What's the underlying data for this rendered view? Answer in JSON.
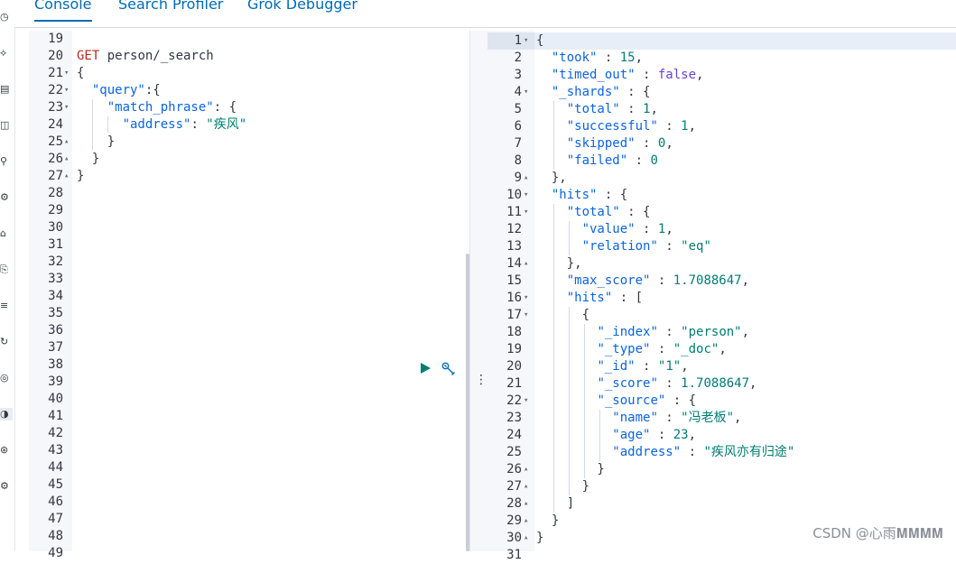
{
  "tabs": [
    {
      "label": "Console",
      "active": true
    },
    {
      "label": "Search Profiler",
      "active": false
    },
    {
      "label": "Grok Debugger",
      "active": false
    }
  ],
  "rail_icons": [
    "clock-icon",
    "discover-icon",
    "dashboard-icon",
    "canvas-icon",
    "maps-icon",
    "ml-icon",
    "stack-icon",
    "graph-icon",
    "logs-icon",
    "apm-icon",
    "uptime-icon",
    "dev-tools-icon",
    "monitoring-icon",
    "management-icon"
  ],
  "request": {
    "lines": [
      {
        "n": "19",
        "fold": "",
        "tokens": []
      },
      {
        "n": "20",
        "fold": "",
        "tokens": [
          {
            "t": "GET",
            "c": "m"
          },
          {
            "t": " person/_search",
            "c": "p"
          }
        ]
      },
      {
        "n": "21",
        "fold": "▾",
        "tokens": [
          {
            "t": "{",
            "c": "p"
          }
        ]
      },
      {
        "n": "22",
        "fold": "▾",
        "tokens": [
          {
            "t": "  ",
            "c": "p"
          },
          {
            "t": "\"query\"",
            "c": "k"
          },
          {
            "t": ":{",
            "c": "p"
          }
        ]
      },
      {
        "n": "23",
        "fold": "▾",
        "tokens": [
          {
            "t": "    ",
            "c": "p"
          },
          {
            "t": "\"match_phrase\"",
            "c": "k"
          },
          {
            "t": ": {",
            "c": "p"
          }
        ]
      },
      {
        "n": "24",
        "fold": "",
        "tokens": [
          {
            "t": "      ",
            "c": "p"
          },
          {
            "t": "\"address\"",
            "c": "k"
          },
          {
            "t": ": ",
            "c": "p"
          },
          {
            "t": "\"疾风\"",
            "c": "s"
          }
        ]
      },
      {
        "n": "25",
        "fold": "▴",
        "tokens": [
          {
            "t": "    }",
            "c": "p"
          }
        ]
      },
      {
        "n": "26",
        "fold": "▴",
        "tokens": [
          {
            "t": "  }",
            "c": "p"
          }
        ]
      },
      {
        "n": "27",
        "fold": "▴",
        "tokens": [
          {
            "t": "}",
            "c": "p"
          }
        ]
      },
      {
        "n": "28",
        "fold": "",
        "tokens": []
      },
      {
        "n": "29",
        "fold": "",
        "tokens": []
      },
      {
        "n": "30",
        "fold": "",
        "tokens": []
      },
      {
        "n": "31",
        "fold": "",
        "tokens": []
      },
      {
        "n": "32",
        "fold": "",
        "tokens": []
      },
      {
        "n": "33",
        "fold": "",
        "tokens": []
      },
      {
        "n": "34",
        "fold": "",
        "tokens": []
      },
      {
        "n": "35",
        "fold": "",
        "tokens": []
      },
      {
        "n": "36",
        "fold": "",
        "tokens": []
      },
      {
        "n": "37",
        "fold": "",
        "tokens": []
      },
      {
        "n": "38",
        "fold": "",
        "tokens": []
      },
      {
        "n": "39",
        "fold": "",
        "tokens": []
      },
      {
        "n": "40",
        "fold": "",
        "tokens": []
      },
      {
        "n": "41",
        "fold": "",
        "tokens": []
      },
      {
        "n": "42",
        "fold": "",
        "tokens": []
      },
      {
        "n": "43",
        "fold": "",
        "tokens": []
      },
      {
        "n": "44",
        "fold": "",
        "tokens": []
      },
      {
        "n": "45",
        "fold": "",
        "tokens": []
      },
      {
        "n": "46",
        "fold": "",
        "tokens": []
      },
      {
        "n": "47",
        "fold": "",
        "tokens": []
      },
      {
        "n": "48",
        "fold": "",
        "tokens": []
      },
      {
        "n": "49",
        "fold": "",
        "tokens": []
      }
    ]
  },
  "response": {
    "lines": [
      {
        "n": "1",
        "fold": "▾",
        "tokens": [
          {
            "t": "{",
            "c": "p"
          }
        ]
      },
      {
        "n": "2",
        "fold": "",
        "tokens": [
          {
            "t": "  ",
            "c": "p"
          },
          {
            "t": "\"took\"",
            "c": "k"
          },
          {
            "t": " : ",
            "c": "p"
          },
          {
            "t": "15",
            "c": "n"
          },
          {
            "t": ",",
            "c": "p"
          }
        ]
      },
      {
        "n": "3",
        "fold": "",
        "tokens": [
          {
            "t": "  ",
            "c": "p"
          },
          {
            "t": "\"timed_out\"",
            "c": "k"
          },
          {
            "t": " : ",
            "c": "p"
          },
          {
            "t": "false",
            "c": "b"
          },
          {
            "t": ",",
            "c": "p"
          }
        ]
      },
      {
        "n": "4",
        "fold": "▾",
        "tokens": [
          {
            "t": "  ",
            "c": "p"
          },
          {
            "t": "\"_shards\"",
            "c": "k"
          },
          {
            "t": " : {",
            "c": "p"
          }
        ]
      },
      {
        "n": "5",
        "fold": "",
        "tokens": [
          {
            "t": "    ",
            "c": "p"
          },
          {
            "t": "\"total\"",
            "c": "k"
          },
          {
            "t": " : ",
            "c": "p"
          },
          {
            "t": "1",
            "c": "n"
          },
          {
            "t": ",",
            "c": "p"
          }
        ]
      },
      {
        "n": "6",
        "fold": "",
        "tokens": [
          {
            "t": "    ",
            "c": "p"
          },
          {
            "t": "\"successful\"",
            "c": "k"
          },
          {
            "t": " : ",
            "c": "p"
          },
          {
            "t": "1",
            "c": "n"
          },
          {
            "t": ",",
            "c": "p"
          }
        ]
      },
      {
        "n": "7",
        "fold": "",
        "tokens": [
          {
            "t": "    ",
            "c": "p"
          },
          {
            "t": "\"skipped\"",
            "c": "k"
          },
          {
            "t": " : ",
            "c": "p"
          },
          {
            "t": "0",
            "c": "n"
          },
          {
            "t": ",",
            "c": "p"
          }
        ]
      },
      {
        "n": "8",
        "fold": "",
        "tokens": [
          {
            "t": "    ",
            "c": "p"
          },
          {
            "t": "\"failed\"",
            "c": "k"
          },
          {
            "t": " : ",
            "c": "p"
          },
          {
            "t": "0",
            "c": "n"
          }
        ]
      },
      {
        "n": "9",
        "fold": "▴",
        "tokens": [
          {
            "t": "  },",
            "c": "p"
          }
        ]
      },
      {
        "n": "10",
        "fold": "▾",
        "tokens": [
          {
            "t": "  ",
            "c": "p"
          },
          {
            "t": "\"hits\"",
            "c": "k"
          },
          {
            "t": " : {",
            "c": "p"
          }
        ]
      },
      {
        "n": "11",
        "fold": "▾",
        "tokens": [
          {
            "t": "    ",
            "c": "p"
          },
          {
            "t": "\"total\"",
            "c": "k"
          },
          {
            "t": " : {",
            "c": "p"
          }
        ]
      },
      {
        "n": "12",
        "fold": "",
        "tokens": [
          {
            "t": "      ",
            "c": "p"
          },
          {
            "t": "\"value\"",
            "c": "k"
          },
          {
            "t": " : ",
            "c": "p"
          },
          {
            "t": "1",
            "c": "n"
          },
          {
            "t": ",",
            "c": "p"
          }
        ]
      },
      {
        "n": "13",
        "fold": "",
        "tokens": [
          {
            "t": "      ",
            "c": "p"
          },
          {
            "t": "\"relation\"",
            "c": "k"
          },
          {
            "t": " : ",
            "c": "p"
          },
          {
            "t": "\"eq\"",
            "c": "s"
          }
        ]
      },
      {
        "n": "14",
        "fold": "▴",
        "tokens": [
          {
            "t": "    },",
            "c": "p"
          }
        ]
      },
      {
        "n": "15",
        "fold": "",
        "tokens": [
          {
            "t": "    ",
            "c": "p"
          },
          {
            "t": "\"max_score\"",
            "c": "k"
          },
          {
            "t": " : ",
            "c": "p"
          },
          {
            "t": "1.7088647",
            "c": "n"
          },
          {
            "t": ",",
            "c": "p"
          }
        ]
      },
      {
        "n": "16",
        "fold": "▾",
        "tokens": [
          {
            "t": "    ",
            "c": "p"
          },
          {
            "t": "\"hits\"",
            "c": "k"
          },
          {
            "t": " : [",
            "c": "p"
          }
        ]
      },
      {
        "n": "17",
        "fold": "▾",
        "tokens": [
          {
            "t": "      {",
            "c": "p"
          }
        ]
      },
      {
        "n": "18",
        "fold": "",
        "tokens": [
          {
            "t": "        ",
            "c": "p"
          },
          {
            "t": "\"_index\"",
            "c": "k"
          },
          {
            "t": " : ",
            "c": "p"
          },
          {
            "t": "\"person\"",
            "c": "s"
          },
          {
            "t": ",",
            "c": "p"
          }
        ]
      },
      {
        "n": "19",
        "fold": "",
        "tokens": [
          {
            "t": "        ",
            "c": "p"
          },
          {
            "t": "\"_type\"",
            "c": "k"
          },
          {
            "t": " : ",
            "c": "p"
          },
          {
            "t": "\"_doc\"",
            "c": "s"
          },
          {
            "t": ",",
            "c": "p"
          }
        ]
      },
      {
        "n": "20",
        "fold": "",
        "tokens": [
          {
            "t": "        ",
            "c": "p"
          },
          {
            "t": "\"_id\"",
            "c": "k"
          },
          {
            "t": " : ",
            "c": "p"
          },
          {
            "t": "\"1\"",
            "c": "s"
          },
          {
            "t": ",",
            "c": "p"
          }
        ]
      },
      {
        "n": "21",
        "fold": "",
        "tokens": [
          {
            "t": "        ",
            "c": "p"
          },
          {
            "t": "\"_score\"",
            "c": "k"
          },
          {
            "t": " : ",
            "c": "p"
          },
          {
            "t": "1.7088647",
            "c": "n"
          },
          {
            "t": ",",
            "c": "p"
          }
        ]
      },
      {
        "n": "22",
        "fold": "▾",
        "tokens": [
          {
            "t": "        ",
            "c": "p"
          },
          {
            "t": "\"_source\"",
            "c": "k"
          },
          {
            "t": " : {",
            "c": "p"
          }
        ]
      },
      {
        "n": "23",
        "fold": "",
        "tokens": [
          {
            "t": "          ",
            "c": "p"
          },
          {
            "t": "\"name\"",
            "c": "k"
          },
          {
            "t": " : ",
            "c": "p"
          },
          {
            "t": "\"冯老板\"",
            "c": "s"
          },
          {
            "t": ",",
            "c": "p"
          }
        ]
      },
      {
        "n": "24",
        "fold": "",
        "tokens": [
          {
            "t": "          ",
            "c": "p"
          },
          {
            "t": "\"age\"",
            "c": "k"
          },
          {
            "t": " : ",
            "c": "p"
          },
          {
            "t": "23",
            "c": "n"
          },
          {
            "t": ",",
            "c": "p"
          }
        ]
      },
      {
        "n": "25",
        "fold": "",
        "tokens": [
          {
            "t": "          ",
            "c": "p"
          },
          {
            "t": "\"address\"",
            "c": "k"
          },
          {
            "t": " : ",
            "c": "p"
          },
          {
            "t": "\"疾风亦有归途\"",
            "c": "s"
          }
        ]
      },
      {
        "n": "26",
        "fold": "▴",
        "tokens": [
          {
            "t": "        }",
            "c": "p"
          }
        ]
      },
      {
        "n": "27",
        "fold": "▴",
        "tokens": [
          {
            "t": "      }",
            "c": "p"
          }
        ]
      },
      {
        "n": "28",
        "fold": "▴",
        "tokens": [
          {
            "t": "    ]",
            "c": "p"
          }
        ]
      },
      {
        "n": "29",
        "fold": "▴",
        "tokens": [
          {
            "t": "  }",
            "c": "p"
          }
        ]
      },
      {
        "n": "30",
        "fold": "▴",
        "tokens": [
          {
            "t": "}",
            "c": "p"
          }
        ]
      },
      {
        "n": "31",
        "fold": "",
        "tokens": []
      }
    ]
  },
  "actions": {
    "run_title": "Click to send request",
    "wrench_title": "Request options"
  },
  "watermark": "CSDN @心雨𝐌𝐌𝐌𝐌",
  "colors": {
    "accent": "#006bb4",
    "method": "#bd271e",
    "key": "#0b64dd",
    "string": "#017d73",
    "boolean": "#6a41d3",
    "run": "#017d73"
  }
}
